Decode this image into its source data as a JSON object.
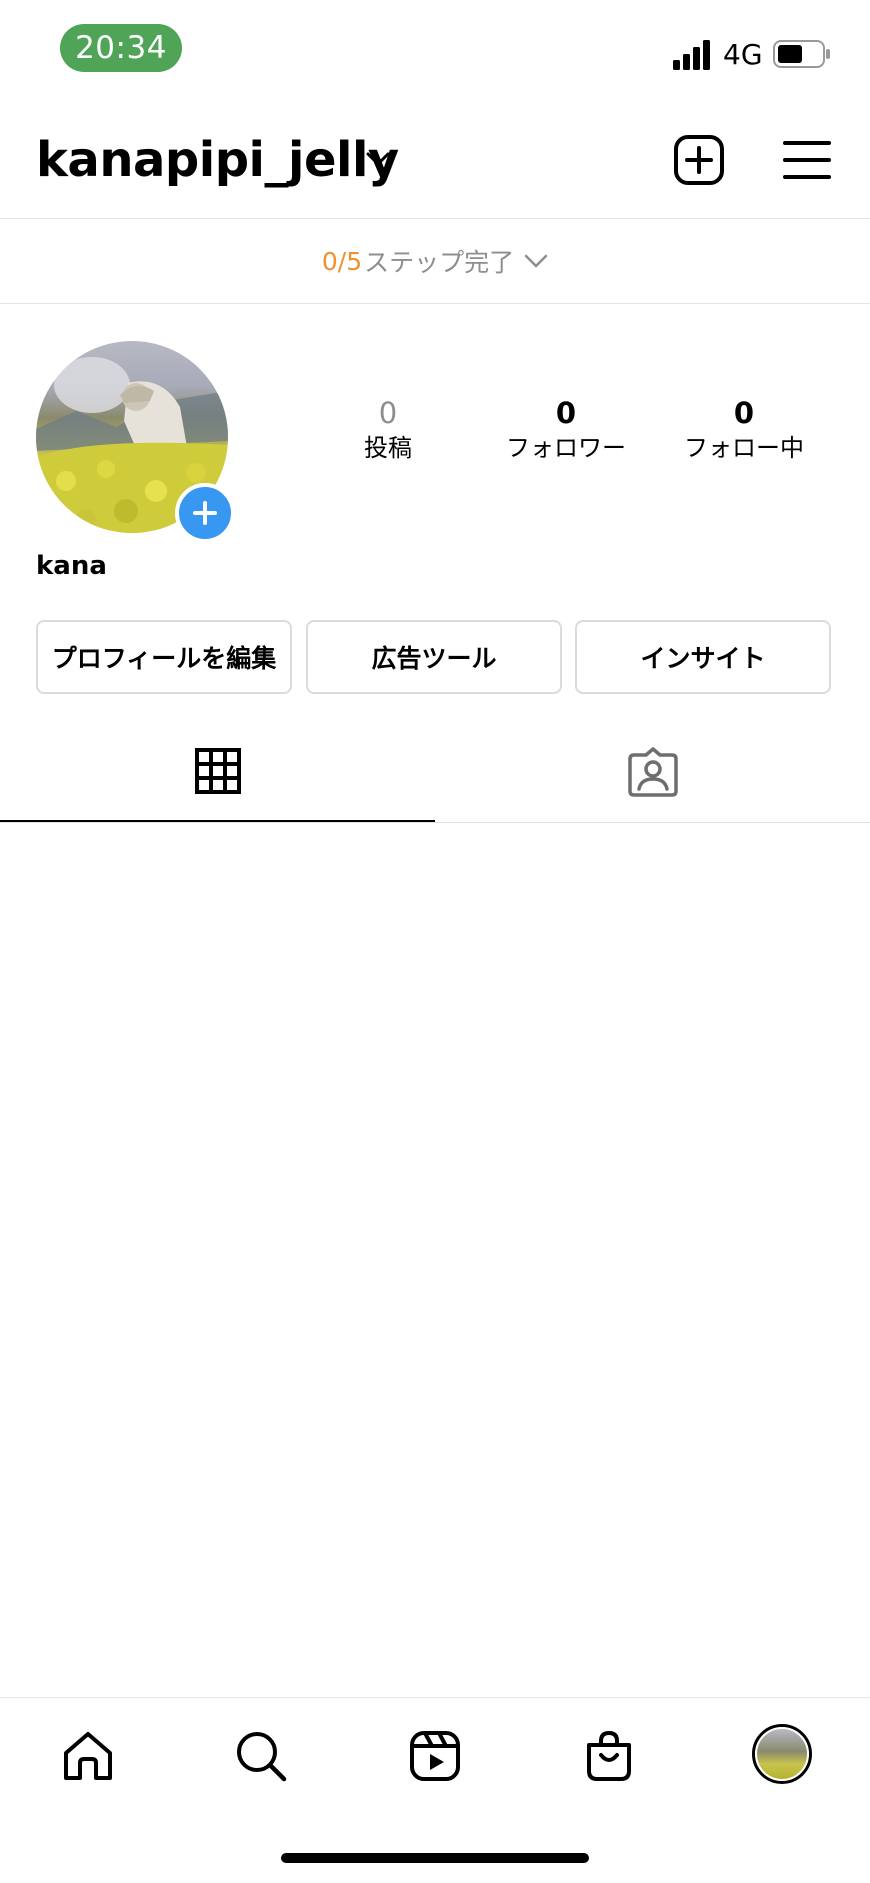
{
  "status_bar": {
    "time": "20:34",
    "network": "4G",
    "time_pill_color": "#4fa457"
  },
  "header": {
    "username": "kanapipi_jelly",
    "icons": [
      "chevron-down-icon",
      "add-post-icon",
      "menu-icon"
    ]
  },
  "steps": {
    "count": "0/5",
    "label": "ステップ完了",
    "count_color": "#f0922d"
  },
  "profile": {
    "display_name": "kana",
    "stats": {
      "posts": {
        "value": "0",
        "label": "投稿"
      },
      "followers": {
        "value": "0",
        "label": "フォロワー"
      },
      "following": {
        "value": "0",
        "label": "フォロー中"
      }
    },
    "add_story_color": "#3897f0"
  },
  "actions": {
    "edit_profile": "プロフィールを編集",
    "ad_tools": "広告ツール",
    "insights": "インサイト"
  },
  "tabs": [
    {
      "icon": "grid-icon",
      "active": true
    },
    {
      "icon": "tagged-icon",
      "active": false
    }
  ],
  "bottom_nav": [
    {
      "icon": "home-icon"
    },
    {
      "icon": "search-icon"
    },
    {
      "icon": "reels-icon"
    },
    {
      "icon": "shop-icon"
    },
    {
      "icon": "profile-avatar-icon"
    }
  ]
}
